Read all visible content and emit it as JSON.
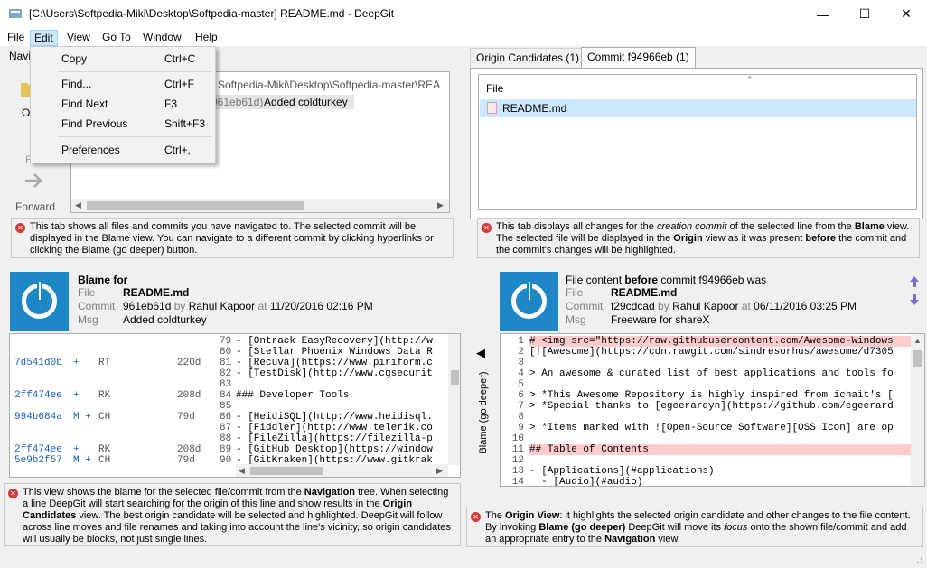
{
  "window": {
    "title": "[C:\\Users\\Softpedia-Miki\\Desktop\\Softpedia-master] README.md - DeepGit",
    "minimize": "—",
    "maximize": "☐",
    "close": "✕"
  },
  "menu": [
    "File",
    "Edit",
    "View",
    "Go To",
    "Window",
    "Help"
  ],
  "dropdown": [
    {
      "label": "Copy",
      "shortcut": "Ctrl+C"
    },
    {
      "label": "Find...",
      "shortcut": "Ctrl+F"
    },
    {
      "label": "Find Next",
      "shortcut": "F3"
    },
    {
      "label": "Find Previous",
      "shortcut": "Shift+F3"
    },
    {
      "label": "Preferences",
      "shortcut": "Ctrl+,"
    }
  ],
  "nav": {
    "tab_fragment": "Navi",
    "open_fragment": "O",
    "back_fragment": "B",
    "forward": "Forward",
    "path": "Softpedia-Miki\\Desktop\\Softpedia-master\\REA",
    "commit_hash": "961eb61d)",
    "commit_msg": "Added coldturkey",
    "note": "This tab shows all files and commits you have navigated to. The selected commit will be displayed in the Blame view. You can navigate to a different commit by clicking hyperlinks or clicking the Blame (go deeper) button."
  },
  "origin": {
    "tabs": [
      "Origin Candidates (1)",
      "Commit f94966eb (1)"
    ],
    "column": "File",
    "file": "README.md",
    "note": "This tab displays all changes for the creation commit of the selected line from the Blame view. The selected file will be displayed in the Origin view as it was present before the commit and the commit's changes will be highlighted."
  },
  "blame": {
    "title": "Blame for",
    "file_k": "File",
    "file_v": "README.md",
    "commit_k": "Commit",
    "commit_v": "961eb61d",
    "by": "by",
    "author": "Rahul Kapoor",
    "at": "at",
    "date": "11/20/2016 02:16 PM",
    "msg_k": "Msg",
    "msg_v": "Added coldturkey",
    "rows": [
      {
        "hash": "",
        "flag": "",
        "auth": "",
        "age": "",
        "num": "79",
        "code": "- [Ontrack EasyRecovery](http://w"
      },
      {
        "hash": "",
        "flag": "",
        "auth": "",
        "age": "",
        "num": "80",
        "code": "- [Stellar Phoenix Windows Data R"
      },
      {
        "hash": "7d541d0b",
        "flag": "+",
        "auth": "RT",
        "age": "220d",
        "num": "81",
        "code": "- [Recuva](https://www.piriform.c"
      },
      {
        "hash": "",
        "flag": "",
        "auth": "",
        "age": "",
        "num": "82",
        "code": "- [TestDisk](http://www.cgsecurit"
      },
      {
        "hash": "",
        "flag": "",
        "auth": "",
        "age": "",
        "num": "83",
        "code": ""
      },
      {
        "hash": "2ff474ee",
        "flag": "+",
        "auth": "RK",
        "age": "208d",
        "num": "84",
        "code": "### Developer Tools"
      },
      {
        "hash": "",
        "flag": "",
        "auth": "",
        "age": "",
        "num": "85",
        "code": ""
      },
      {
        "hash": "994b684a",
        "flag": "M +",
        "auth": "CH",
        "age": "79d",
        "num": "86",
        "code": "- [HeidiSQL](http://www.heidisql."
      },
      {
        "hash": "",
        "flag": "",
        "auth": "",
        "age": "",
        "num": "87",
        "code": "- [Fiddler](http://www.telerik.co"
      },
      {
        "hash": "",
        "flag": "",
        "auth": "",
        "age": "",
        "num": "88",
        "code": "- [FileZilla](https://filezilla-p"
      },
      {
        "hash": "2ff474ee",
        "flag": "+",
        "auth": "RK",
        "age": "208d",
        "num": "89",
        "code": "- [GitHub Desktop](https://window"
      },
      {
        "hash": "5e9b2f57",
        "flag": "M +",
        "auth": "CH",
        "age": "79d",
        "num": "90",
        "code": "- [GitKraken](https://www.gitkrak"
      }
    ],
    "note": "This view shows the blame for the selected file/commit from the Navigation tree. When selecting a line DeepGit will start searching for the origin of this line and show results in the Origin Candidates view. The best origin candidate will be selected and highlighted. DeepGit will follow across line moves and file renames and taking into account the line's vicinity, so origin candidates will usually be blocks, not just single lines."
  },
  "origin_view": {
    "title_pre": "File content",
    "title_bold": "before",
    "title_post": "commit f94966eb was",
    "file_k": "File",
    "file_v": "README.md",
    "commit_k": "Commit",
    "commit_v": "f29cdcad",
    "by": "by",
    "author": "Rahul Kapoor",
    "at": "at",
    "date": "06/11/2016 03:25 PM",
    "msg_k": "Msg",
    "msg_v": "Freeware for shareX",
    "go_deeper": "Blame (go deeper)",
    "lines": [
      {
        "n": "1",
        "code": "# <img src=\"https://raw.githubusercontent.com/Awesome-Windows",
        "hl": true
      },
      {
        "n": "2",
        "code": "[![Awesome](https://cdn.rawgit.com/sindresorhus/awesome/d7305",
        "hl": false
      },
      {
        "n": "3",
        "code": "",
        "hl": false
      },
      {
        "n": "4",
        "code": "> An awesome & curated list of best applications and tools fo",
        "hl": false
      },
      {
        "n": "5",
        "code": "",
        "hl": false
      },
      {
        "n": "6",
        "code": "> *This Awesome Repository is highly inspired from ichait's [",
        "hl": false
      },
      {
        "n": "7",
        "code": "> *Special thanks to [egeerardyn](https://github.com/egeerard",
        "hl": false
      },
      {
        "n": "8",
        "code": "",
        "hl": false
      },
      {
        "n": "9",
        "code": "> *Items marked with ![Open-Source Software][OSS Icon] are op",
        "hl": false
      },
      {
        "n": "10",
        "code": "",
        "hl": false
      },
      {
        "n": "11",
        "code": "## Table of Contents",
        "hl": true
      },
      {
        "n": "12",
        "code": "",
        "hl": false
      },
      {
        "n": "13",
        "code": "- [Applications](#applications)",
        "hl": false
      },
      {
        "n": "14",
        "code": "  - [Audio](#audio)",
        "hl": false
      }
    ],
    "note": "The Origin View: it highlights the selected origin candidate and other changes to the file content. By invoking Blame (go deeper) DeepGit will move its focus onto the shown file/commit and add an appropriate entry to the Navigation view."
  },
  "colors": {
    "accent": "#1e88c7",
    "highlight": "#ffcccc",
    "selection": "#cce8ff"
  }
}
